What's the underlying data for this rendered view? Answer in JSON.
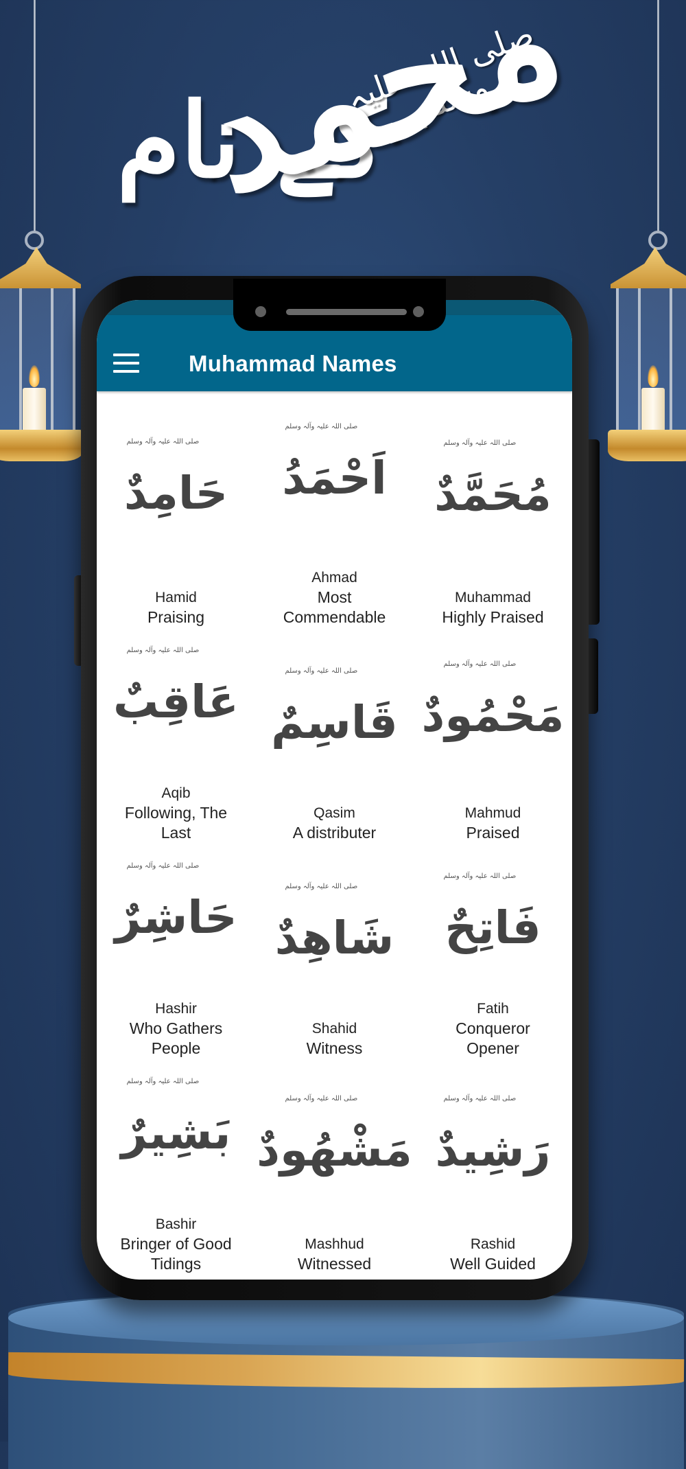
{
  "banner": {
    "calligraphy_name": "محمد",
    "calligraphy_suffix": "کے نام",
    "honorific": "صلی اللہ علیہ وسلم"
  },
  "app": {
    "title": "Muhammad Names",
    "menu_icon": "hamburger-menu-icon",
    "colors": {
      "appbar": "#02668b",
      "statusbar": "#0b5874",
      "background": "#253f66",
      "gold": "#d9a553"
    }
  },
  "names_honorific": "صلی اللہ علیہ وآلہ وسلم",
  "names": [
    {
      "arabic": "حَامِدٌ",
      "name": "Hamid",
      "meaning": "Praising"
    },
    {
      "arabic": "اَحْمَدُ",
      "name": "Ahmad",
      "meaning": "Most Commendable"
    },
    {
      "arabic": "مُحَمَّدٌ",
      "name": "Muhammad",
      "meaning": "Highly Praised"
    },
    {
      "arabic": "عَاقِبٌ",
      "name": "Aqib",
      "meaning": "Following, The Last"
    },
    {
      "arabic": "قَاسِمٌ",
      "name": "Qasim",
      "meaning": "A distributer"
    },
    {
      "arabic": "مَحْمُودٌ",
      "name": "Mahmud",
      "meaning": "Praised"
    },
    {
      "arabic": "حَاشِرٌ",
      "name": "Hashir",
      "meaning": "Who Gathers People"
    },
    {
      "arabic": "شَاهِدٌ",
      "name": "Shahid",
      "meaning": "Witness"
    },
    {
      "arabic": "فَاتِحٌ",
      "name": "Fatih",
      "meaning": "Conqueror Opener"
    },
    {
      "arabic": "بَشِيرٌ",
      "name": "Bashir",
      "meaning": "Bringer of Good Tidings"
    },
    {
      "arabic": "مَشْهُودٌ",
      "name": "Mashhud",
      "meaning": "Witnessed"
    },
    {
      "arabic": "رَشِيدٌ",
      "name": "Rashid",
      "meaning": "Well Guided"
    }
  ]
}
